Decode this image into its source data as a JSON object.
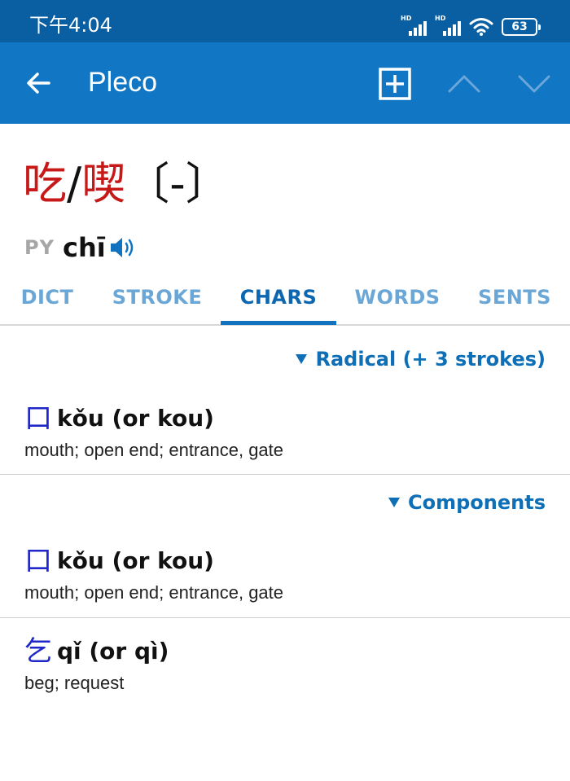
{
  "status_bar": {
    "time": "下午4:04",
    "signal1_label": "HD",
    "signal2_label": "HD",
    "battery": "63"
  },
  "app_bar": {
    "title": "Pleco",
    "icons": [
      "back-arrow-icon",
      "add-box-icon",
      "chevron-up-icon",
      "chevron-down-icon"
    ],
    "color": "#1176c3"
  },
  "headword": {
    "simplified": "吃",
    "separator": "/",
    "traditional": "喫",
    "bracket": "〔-〕",
    "py_label": "PY",
    "pinyin": "chī",
    "color": "#c81919"
  },
  "tabs": [
    {
      "label": "DICT",
      "active": false
    },
    {
      "label": "STROKE",
      "active": false
    },
    {
      "label": "CHARS",
      "active": true
    },
    {
      "label": "WORDS",
      "active": false
    },
    {
      "label": "SENTS",
      "active": false
    }
  ],
  "radical_section": {
    "header": "Radical (+ 3 strokes)",
    "entries": [
      {
        "char": "口",
        "pinyin": "kǒu (or kou)",
        "definition": "mouth; open end; entrance, gate"
      }
    ]
  },
  "components_section": {
    "header": "Components",
    "entries": [
      {
        "char": "口",
        "pinyin": "kǒu (or kou)",
        "definition": "mouth; open end; entrance, gate"
      },
      {
        "char": "乞",
        "pinyin": "qǐ (or qì)",
        "definition": "beg; request"
      }
    ]
  },
  "accent_color": "#0e6fb7"
}
